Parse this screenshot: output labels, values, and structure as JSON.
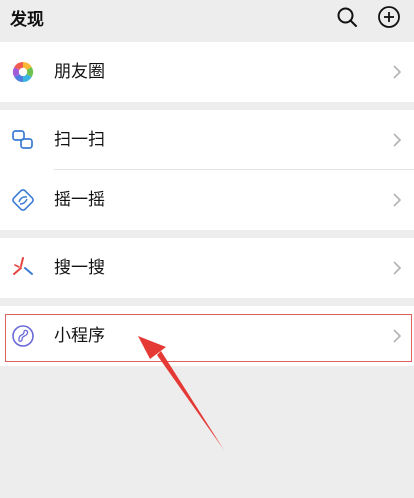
{
  "header": {
    "title": "发现",
    "search_icon": "search-icon",
    "add_icon": "plus-circle-icon"
  },
  "menu": {
    "moments": {
      "label": "朋友圈",
      "icon": "moments-aperture-icon"
    },
    "scan": {
      "label": "扫一扫",
      "icon": "scan-icon"
    },
    "shake": {
      "label": "摇一摇",
      "icon": "shake-icon"
    },
    "search": {
      "label": "搜一搜",
      "icon": "search-sparkle-icon"
    },
    "mini_programs": {
      "label": "小程序",
      "icon": "mini-program-icon"
    }
  },
  "colors": {
    "background": "#ededed",
    "card": "#ffffff",
    "annotation_red": "#e53935",
    "scan_blue": "#3a7bd5",
    "search_red": "#e64340",
    "mini_purple": "#6a6ad8"
  }
}
